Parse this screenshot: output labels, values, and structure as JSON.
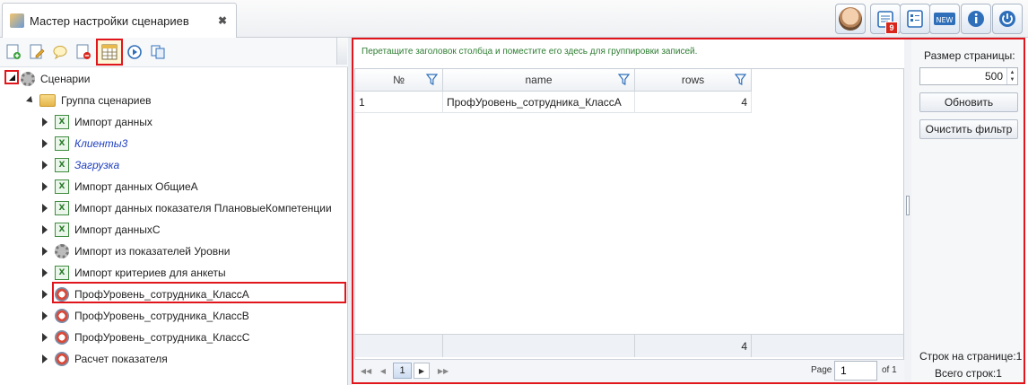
{
  "window": {
    "tab_title": "Мастер настройки сценариев",
    "tab_close": "✖",
    "badge_count": "9"
  },
  "tree": {
    "root_label": "Сценарии",
    "group_label": "Группа сценариев",
    "items": [
      {
        "label": "Импорт данных",
        "icon": "excel-icon",
        "italic": false
      },
      {
        "label": "Клиенты3",
        "icon": "excel-icon",
        "italic": true
      },
      {
        "label": "Загрузка",
        "icon": "excel-icon",
        "italic": true
      },
      {
        "label": "Импорт данных ОбщиеА",
        "icon": "excel-icon",
        "italic": false
      },
      {
        "label": "Импорт данных показателя ПлановыеКомпетенции",
        "icon": "excel-icon",
        "italic": false
      },
      {
        "label": "Импорт данныхС",
        "icon": "excel-icon",
        "italic": false
      },
      {
        "label": "Импорт из показателей Уровни",
        "icon": "gear-icon",
        "italic": false
      },
      {
        "label": "Импорт критериев для анкеты",
        "icon": "excel-icon",
        "italic": false
      },
      {
        "label": "ПрофУровень_сотрудника_КлассА",
        "icon": "scenario-icon",
        "italic": false
      },
      {
        "label": "ПрофУровень_сотрудника_КлассB",
        "icon": "scenario-icon",
        "italic": false
      },
      {
        "label": "ПрофУровень_сотрудника_КлассC",
        "icon": "scenario-icon",
        "italic": false
      },
      {
        "label": "Расчет показателя",
        "icon": "scenario-icon",
        "italic": false
      }
    ]
  },
  "grid": {
    "group_hint": "Перетащите заголовок столбца и поместите его здесь для группировки записей.",
    "columns": [
      "№",
      "name",
      "rows"
    ],
    "rows": [
      {
        "num": "1",
        "name": "ПрофУровень_сотрудника_КлассА",
        "rows": "4"
      }
    ],
    "footer_rows_total": "4",
    "pager": {
      "current_page": "1",
      "page_label": "Page",
      "page_value": "1",
      "of_label": "of 1"
    }
  },
  "side": {
    "page_size_label": "Размер страницы:",
    "page_size_value": "500",
    "refresh_label": "Обновить",
    "clear_filter_label": "Очистить фильтр",
    "rows_on_page": "Строк на странице:1",
    "rows_total": "Всего строк:1"
  },
  "colors": {
    "highlight": "#e0161c",
    "accent_blue": "#2f6fba",
    "hint_green": "#2e7d32"
  }
}
